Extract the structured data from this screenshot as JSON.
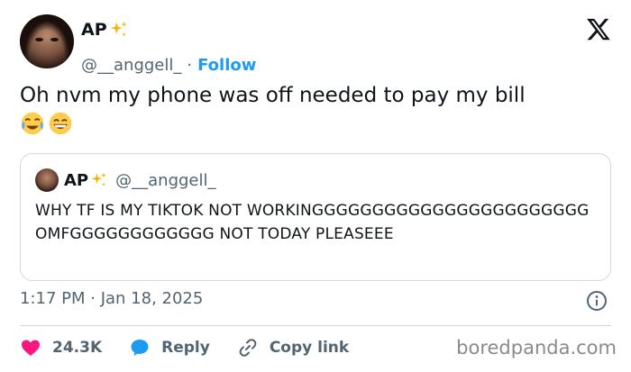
{
  "author": {
    "display_name": "AP",
    "handle": "@__anggell_",
    "separator": "·",
    "follow_label": "Follow"
  },
  "tweet": {
    "text": "Oh nvm my phone was off needed to pay my bill",
    "emojis": [
      "face-with-tears-of-joy",
      "grinning-face-with-smiling-eyes"
    ]
  },
  "quote": {
    "display_name": "AP",
    "handle": "@__anggell_",
    "text": "WHY TF IS MY TIKTOK NOT WORKINGGGGGGGGGGGGGGGGGGGGGGG OMFGGGGGGGGGGGG NOT TODAY PLEASEEE"
  },
  "meta": {
    "timestamp": "1:17 PM · Jan 18, 2025"
  },
  "actions": {
    "like_count": "24.3K",
    "reply_label": "Reply",
    "copy_link_label": "Copy link"
  },
  "watermark": "boredpanda.com",
  "colors": {
    "accent": "#1d9bf0",
    "like": "#f91880",
    "secondary_text": "#536471",
    "border": "#cfd9de"
  },
  "icons": {
    "logo": "x-logo-icon",
    "sparkle": "sparkles-icon",
    "info": "info-icon",
    "like": "heart-icon",
    "reply": "speech-bubble-icon",
    "copy": "link-icon"
  }
}
